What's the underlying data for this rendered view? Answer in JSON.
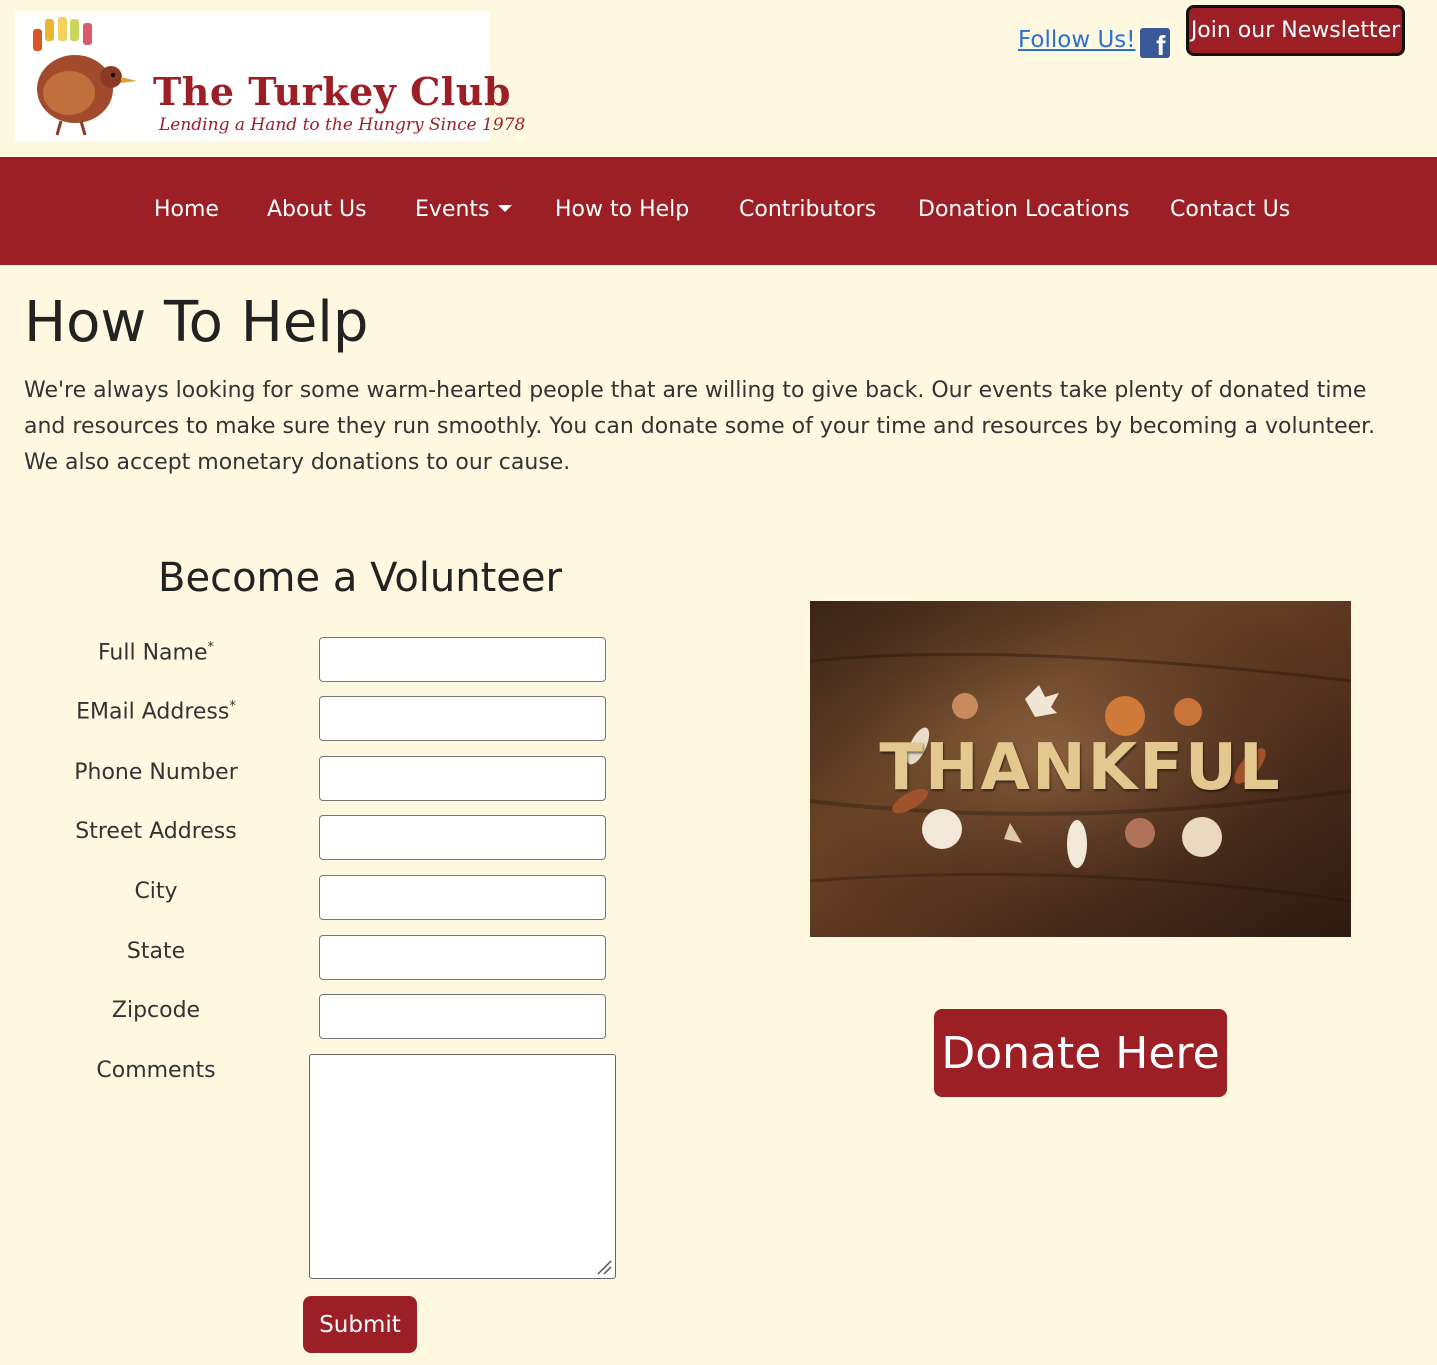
{
  "header": {
    "logo_title": "The Turkey Club",
    "logo_tagline": "Lending a Hand to the Hungry Since 1978",
    "follow_label": "Follow Us!",
    "follow_icon": "facebook-icon",
    "newsletter_label": "Join our Newsletter"
  },
  "nav": {
    "items": [
      {
        "label": "Home"
      },
      {
        "label": "About Us"
      },
      {
        "label": "Events",
        "has_dropdown": true
      },
      {
        "label": "How to Help"
      },
      {
        "label": "Contributors"
      },
      {
        "label": "Donation Locations"
      },
      {
        "label": "Contact Us"
      }
    ]
  },
  "main": {
    "title": "How To Help",
    "intro": "We're always looking for some warm-hearted people that are willing to give back. Our events take plenty of donated time and resources to make sure they run smoothly. You can donate some of your time and resources by becoming a volunteer. We also accept monetary donations to our cause."
  },
  "volunteer_form": {
    "title": "Become a Volunteer",
    "required_marker": "*",
    "fields": [
      {
        "label": "Full Name",
        "value": ""
      },
      {
        "label": "EMail Address",
        "value": ""
      },
      {
        "label": "Phone Number",
        "value": ""
      },
      {
        "label": "Street Address",
        "value": ""
      },
      {
        "label": "City",
        "value": ""
      },
      {
        "label": "State",
        "value": ""
      },
      {
        "label": "Zipcode",
        "value": ""
      }
    ],
    "comments_label": "Comments",
    "comments_value": "",
    "submit_label": "Submit"
  },
  "donate": {
    "image_text": "THANKFUL",
    "button_label": "Donate Here"
  },
  "colors": {
    "background": "#fdf8df",
    "brand_red": "#9c1f25",
    "link_blue": "#2a6fd6"
  }
}
